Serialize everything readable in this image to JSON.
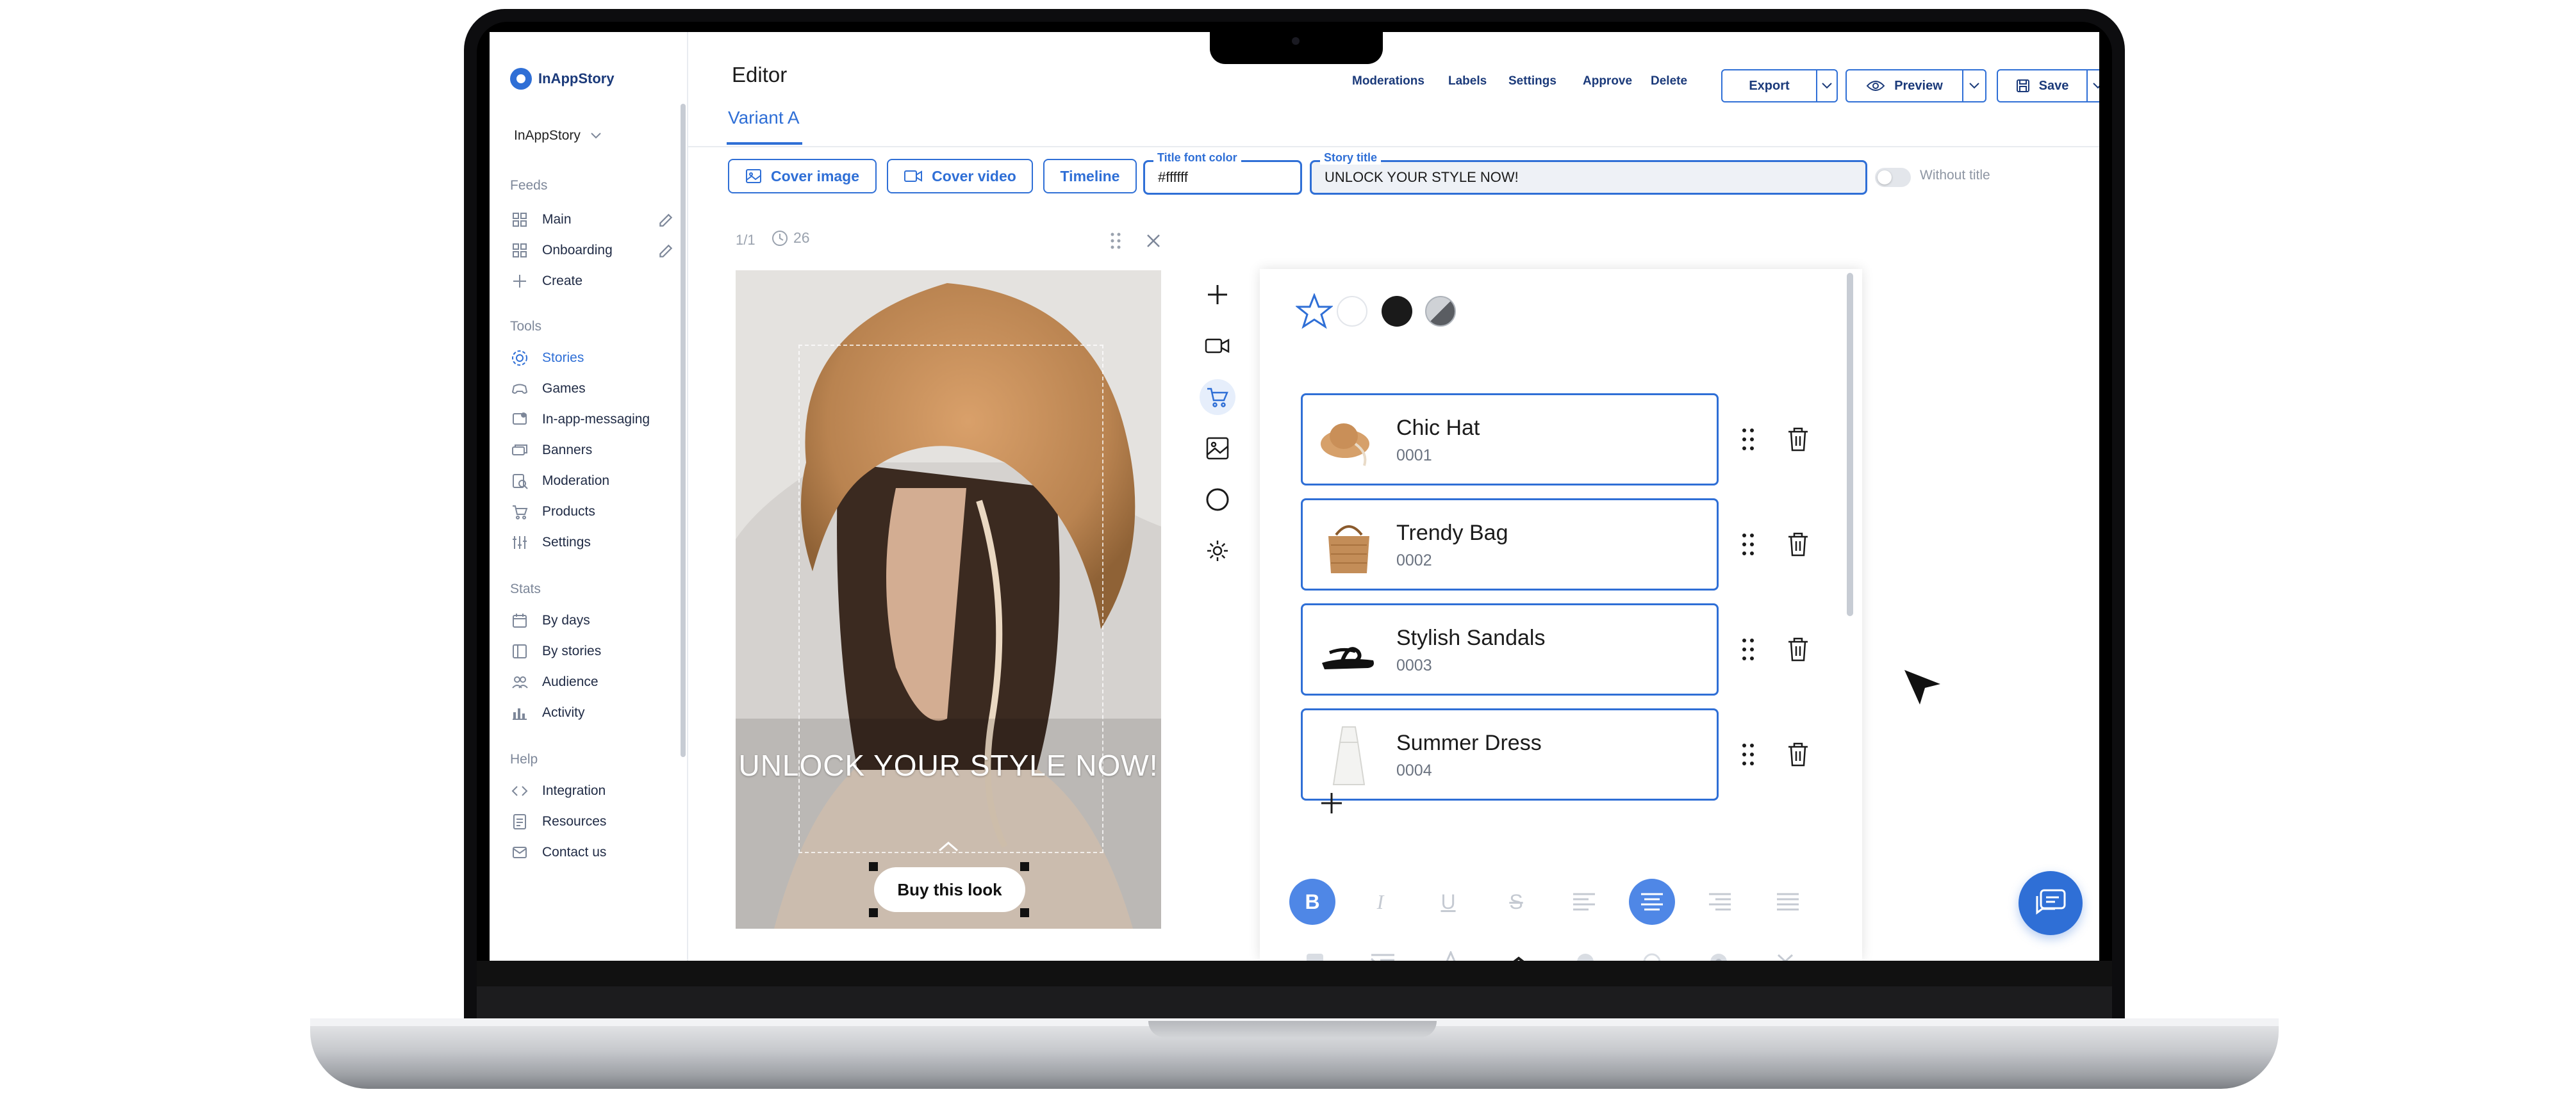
{
  "brand": {
    "name": "InAppStory"
  },
  "workspace": {
    "name": "InAppStory"
  },
  "sidebar": {
    "feeds_title": "Feeds",
    "feeds": [
      {
        "label": "Main"
      },
      {
        "label": "Onboarding"
      },
      {
        "label": "Create"
      }
    ],
    "tools_title": "Tools",
    "tools": [
      {
        "label": "Stories"
      },
      {
        "label": "Games"
      },
      {
        "label": "In-app-messaging"
      },
      {
        "label": "Banners"
      },
      {
        "label": "Moderation"
      },
      {
        "label": "Products"
      },
      {
        "label": "Settings"
      }
    ],
    "stats_title": "Stats",
    "stats": [
      {
        "label": "By days"
      },
      {
        "label": "By stories"
      },
      {
        "label": "Audience"
      },
      {
        "label": "Activity"
      }
    ],
    "help_title": "Help",
    "help": [
      {
        "label": "Integration"
      },
      {
        "label": "Resources"
      },
      {
        "label": "Contact us"
      }
    ]
  },
  "header": {
    "title": "Editor",
    "variant_tab": "Variant A",
    "links": [
      "Moderations",
      "Labels",
      "Settings",
      "Approve",
      "Delete"
    ],
    "export_label": "Export",
    "preview_label": "Preview",
    "save_label": "Save"
  },
  "toolbar": {
    "cover_image": "Cover image",
    "cover_video": "Cover video",
    "timeline": "Timeline",
    "title_font_color_label": "Title font color",
    "title_font_color_value": "#ffffff",
    "story_title_label": "Story title",
    "story_title_value": "UNLOCK YOUR STYLE NOW!",
    "without_title_label": "Without title",
    "without_title_on": false
  },
  "slide": {
    "counter": "1/1",
    "duration": "26",
    "caption": "UNLOCK YOUR STYLE NOW!",
    "button_label": "Buy this look"
  },
  "products_panel": {
    "swatch_colors": [
      "#ffffff",
      "#1a1a1a"
    ],
    "products": [
      {
        "name": "Chic Hat",
        "code": "0001"
      },
      {
        "name": "Trendy Bag",
        "code": "0002"
      },
      {
        "name": "Stylish Sandals",
        "code": "0003"
      },
      {
        "name": "Summer Dress",
        "code": "0004"
      }
    ]
  },
  "colors": {
    "accent": "#2f6fd6",
    "text": "#1f2a44",
    "muted": "#7d8799"
  }
}
